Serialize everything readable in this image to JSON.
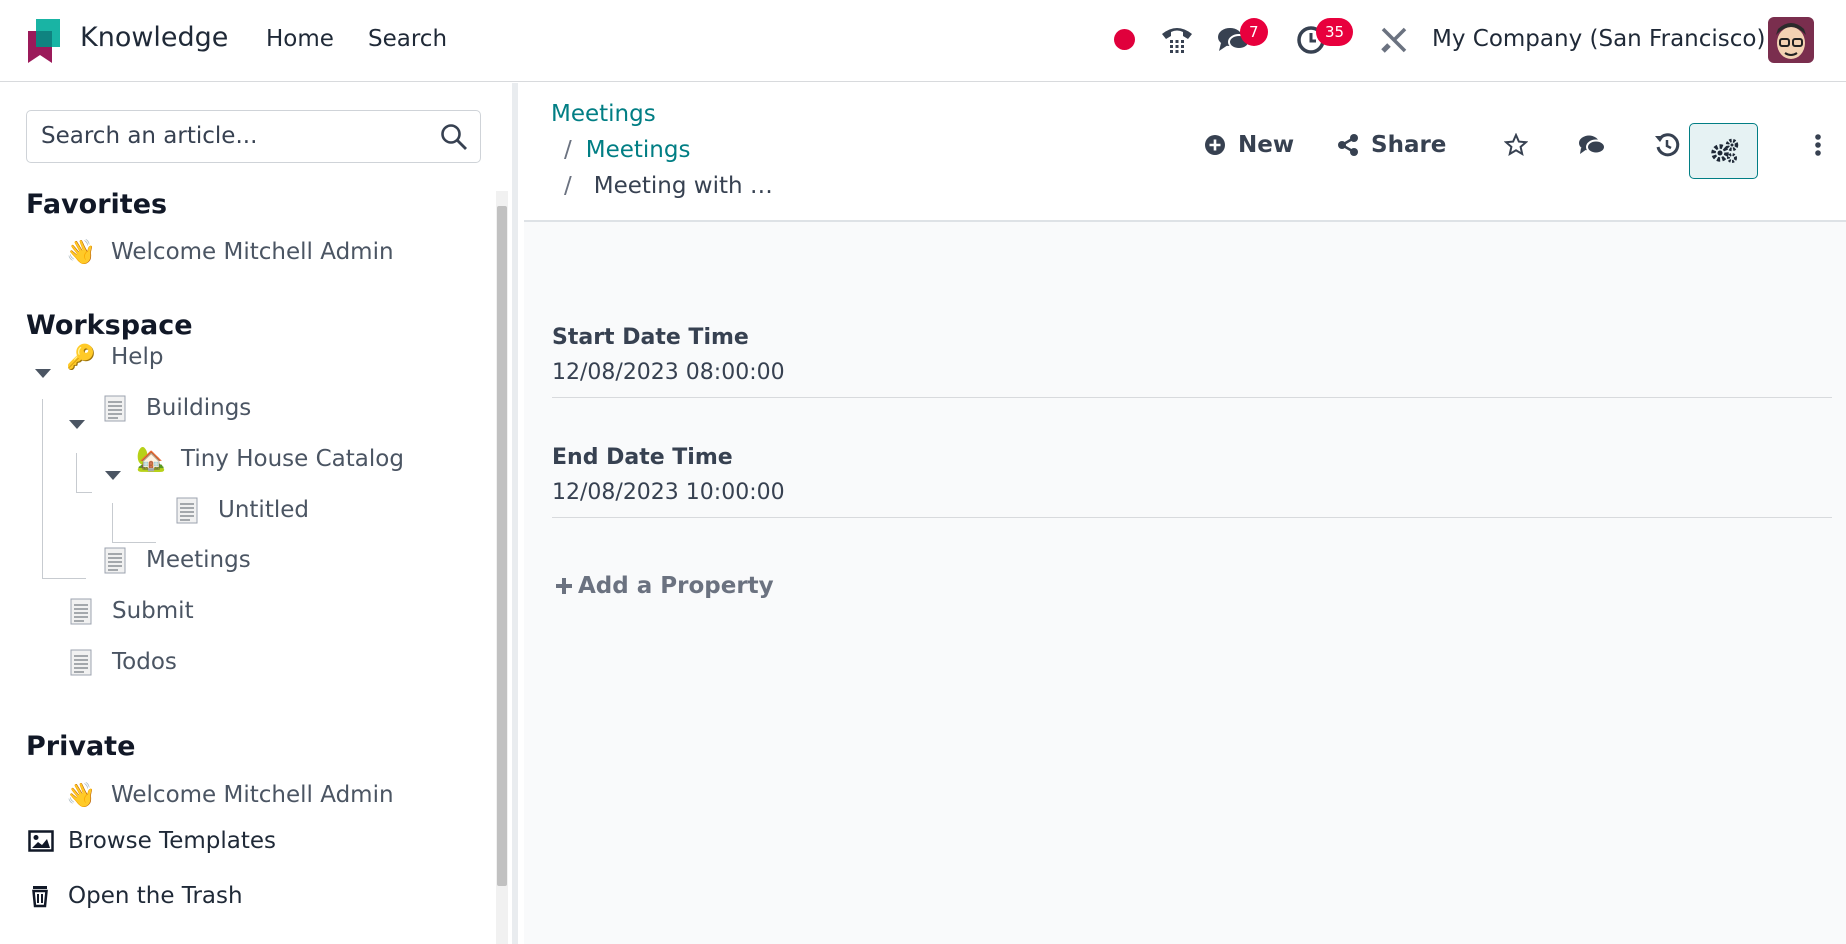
{
  "app": {
    "name": "Knowledge",
    "nav": [
      "Home",
      "Search"
    ],
    "company": "My Company (San Francisco)",
    "messages_count": "7",
    "activities_count": "35",
    "colors": {
      "accent": "#017e84",
      "badge": "#e8003d",
      "record": "#e0003c"
    }
  },
  "sidebar": {
    "search_placeholder": "Search an article...",
    "favorites_title": "Favorites",
    "favorites": [
      {
        "icon": "👋",
        "label": "Welcome Mitchell Admin"
      }
    ],
    "workspace_title": "Workspace",
    "workspace": [
      {
        "icon": "🔑",
        "label": "Help"
      },
      {
        "icon": "doc-icon",
        "label": "Buildings"
      },
      {
        "icon": "🏡",
        "label": "Tiny House Catalog"
      },
      {
        "icon": "doc-icon",
        "label": "Untitled"
      },
      {
        "icon": "doc-icon",
        "label": "Meetings"
      },
      {
        "icon": "doc-icon",
        "label": "Submit"
      },
      {
        "icon": "doc-icon",
        "label": "Todos"
      }
    ],
    "private_title": "Private",
    "private": [
      {
        "icon": "👋",
        "label": "Welcome Mitchell Admin"
      }
    ],
    "browse_templates": "Browse Templates",
    "open_trash": "Open the Trash"
  },
  "main": {
    "breadcrumb": [
      "Meetings",
      "Meetings",
      "Meeting with …"
    ],
    "breadcrumb_sep": "/",
    "new_label": "New",
    "share_label": "Share",
    "properties": [
      {
        "label": "Start Date Time",
        "value": "12/08/2023 08:00:00"
      },
      {
        "label": "End Date Time",
        "value": "12/08/2023 10:00:00"
      }
    ],
    "add_property_label": "Add a Property"
  }
}
